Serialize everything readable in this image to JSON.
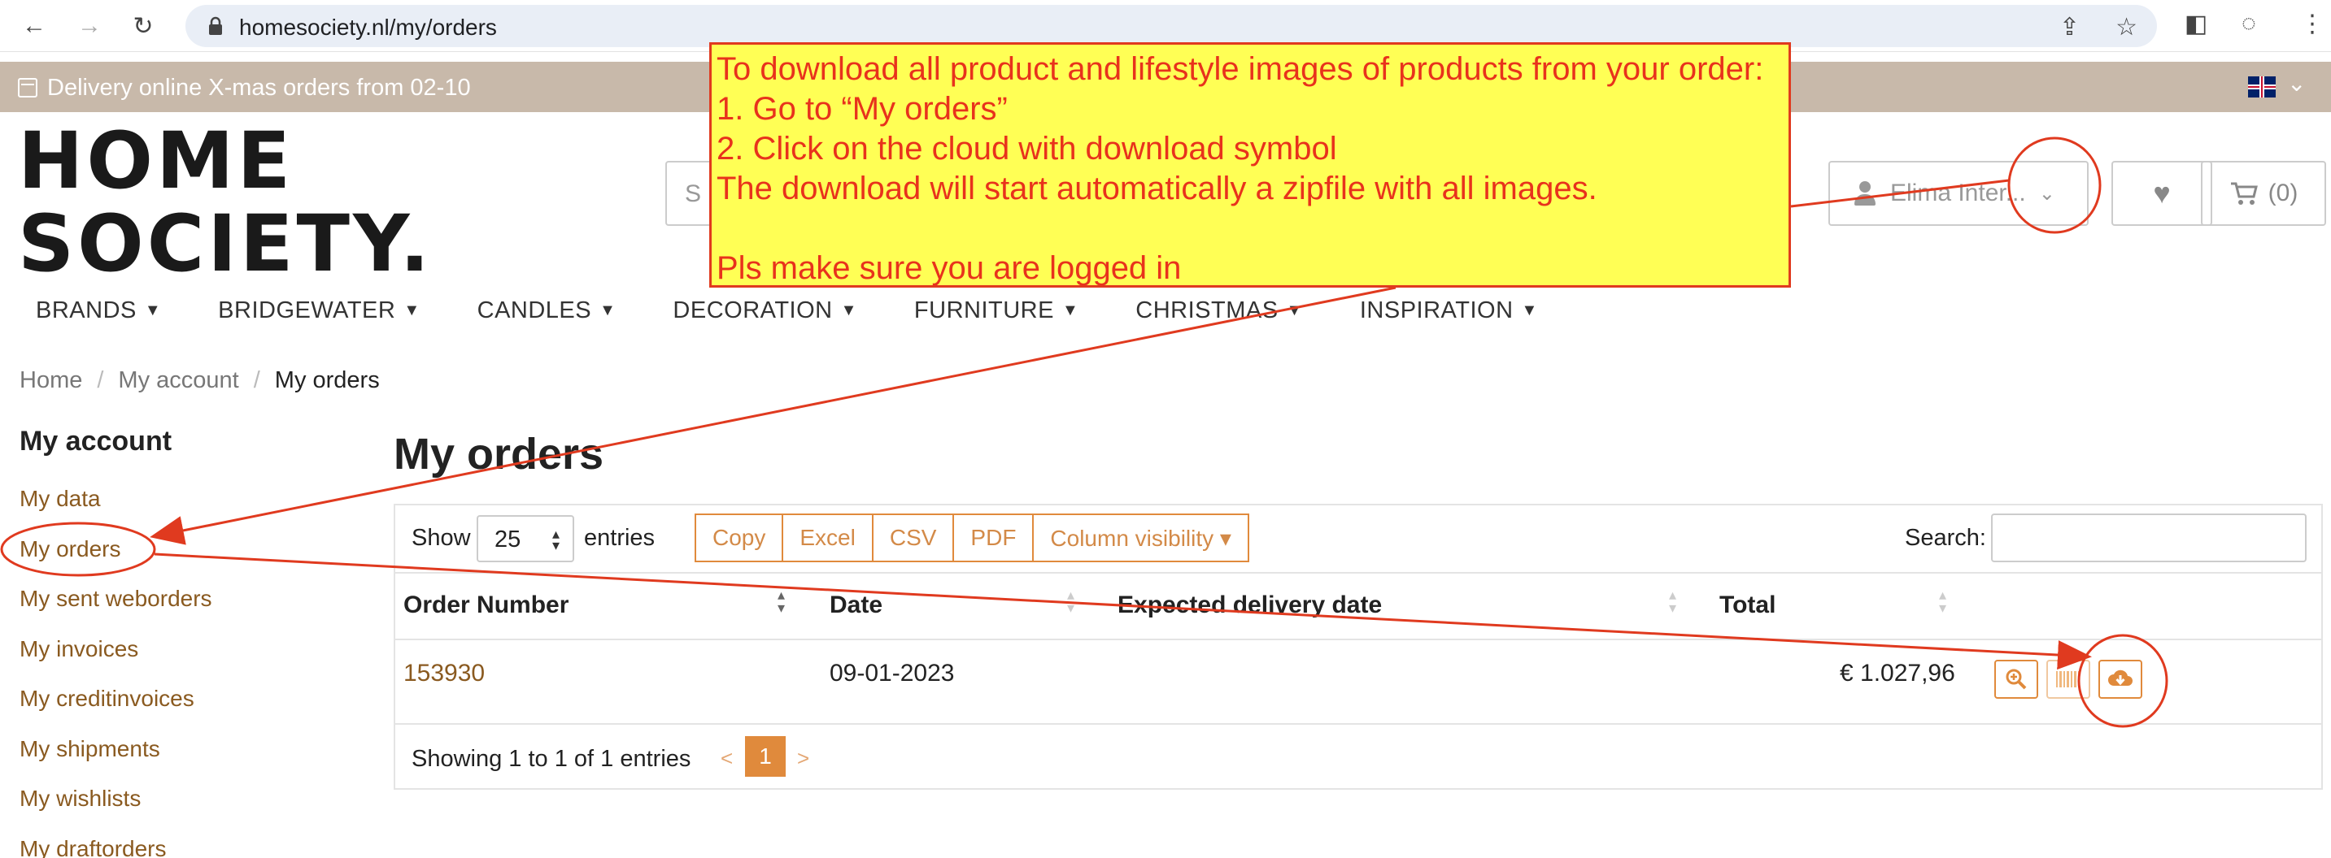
{
  "browser": {
    "url": "homesociety.nl/my/orders"
  },
  "notice": {
    "text": "Delivery online X-mas orders from 02-10"
  },
  "logo": {
    "line1": "HOME",
    "line2": "SOCIETY."
  },
  "header": {
    "search_placeholder": "S",
    "account_label": "Elima Inter...",
    "cart_label": "(0)"
  },
  "nav": {
    "items": [
      "BRANDS",
      "BRIDGEWATER",
      "CANDLES",
      "DECORATION",
      "FURNITURE",
      "CHRISTMAS",
      "INSPIRATION"
    ]
  },
  "breadcrumb": {
    "items": [
      "Home",
      "My account",
      "My orders"
    ]
  },
  "sidebar": {
    "title": "My account",
    "items": [
      "My data",
      "My orders",
      "My sent weborders",
      "My invoices",
      "My creditinvoices",
      "My shipments",
      "My wishlists",
      "My draftorders"
    ]
  },
  "main": {
    "title": "My orders",
    "show_label": "Show",
    "entries_value": "25",
    "entries_label": "entries",
    "buttons": [
      "Copy",
      "Excel",
      "CSV",
      "PDF",
      "Column visibility ▾"
    ],
    "search_label": "Search:",
    "columns": [
      "Order Number",
      "Date",
      "Expected delivery date",
      "Total"
    ],
    "rows": [
      {
        "order_number": "153930",
        "date": "09-01-2023",
        "expected": "",
        "total": "€ 1.027,96"
      }
    ],
    "info": "Showing 1 to 1 of 1 entries",
    "pager": {
      "prev": "<",
      "current": "1",
      "next": ">"
    }
  },
  "annotation": {
    "lines": [
      "To download all product and lifestyle images of products from your order:",
      "1. Go to “My orders”",
      "2. Click on the cloud with download symbol",
      "The download will start automatically a zipfile with all images.",
      "",
      "Pls make sure you are logged in"
    ],
    "color": "#e8321c",
    "background": "#ffff55"
  }
}
